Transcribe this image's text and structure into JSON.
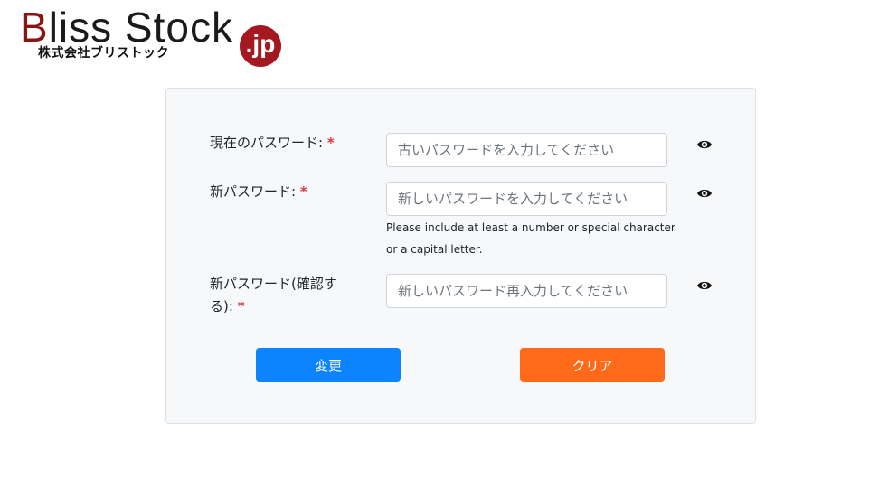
{
  "brand": {
    "title_first": "B",
    "title_rest": "liss Stock",
    "badge": ".jp",
    "subtitle": "株式会社ブリストック",
    "colors": {
      "title_first": "#8a1515",
      "badge": "#a3191f"
    }
  },
  "form": {
    "current_password": {
      "label": "現在のパスワード:",
      "required_mark": "*",
      "placeholder": "古いパスワードを入力してください",
      "value": "",
      "toggle_icon": "eye-icon"
    },
    "new_password": {
      "label": "新パスワード:",
      "required_mark": "*",
      "placeholder": "新しいパスワードを入力してください",
      "value": "",
      "hint": "Please include at least a number or special character or a capital letter.",
      "toggle_icon": "eye-icon"
    },
    "confirm_password": {
      "label": "新パスワード(確認する):",
      "required_mark": "*",
      "placeholder": "新しいパスワード再入力してください",
      "value": "",
      "toggle_icon": "eye-icon"
    },
    "buttons": {
      "change_label": "変更",
      "clear_label": "クリア",
      "colors": {
        "change": "#0d84ff",
        "clear": "#ff6a1a"
      }
    }
  }
}
